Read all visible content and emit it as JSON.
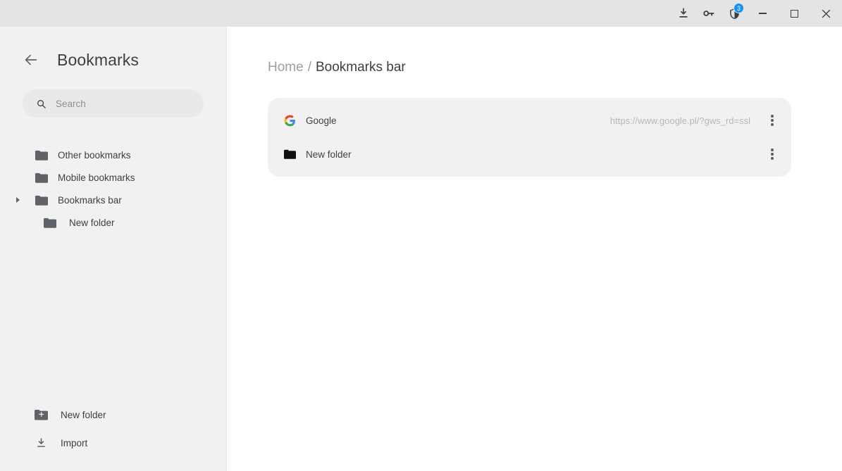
{
  "titlebar": {
    "icons": [
      {
        "name": "downloads-icon",
        "label": "Downloads"
      },
      {
        "name": "password-key-icon",
        "label": "Passwords"
      },
      {
        "name": "shield-icon",
        "label": "Protection",
        "badge": "3"
      }
    ],
    "window_controls": {
      "minimize": "Minimize",
      "maximize": "Maximize",
      "close": "Close"
    }
  },
  "sidebar": {
    "back_label": "Back",
    "title": "Bookmarks",
    "search": {
      "placeholder": "Search",
      "value": ""
    },
    "tree": [
      {
        "label": "Other bookmarks",
        "icon": "folder-icon",
        "expandable": false,
        "child": false
      },
      {
        "label": "Mobile bookmarks",
        "icon": "folder-icon",
        "expandable": false,
        "child": false
      },
      {
        "label": "Bookmarks bar",
        "icon": "folder-icon",
        "expandable": true,
        "child": false
      },
      {
        "label": "New folder",
        "icon": "folder-icon",
        "expandable": false,
        "child": true
      }
    ],
    "footer": [
      {
        "label": "New folder",
        "icon": "new-folder-icon"
      },
      {
        "label": "Import",
        "icon": "import-icon"
      }
    ]
  },
  "main": {
    "breadcrumb": {
      "home": "Home",
      "separator": "/",
      "current": "Bookmarks bar"
    },
    "rows": [
      {
        "title": "Google",
        "url": "https://www.google.pl/?gws_rd=ssl",
        "icon": "google-favicon"
      },
      {
        "title": "New folder",
        "url": "",
        "icon": "folder-icon-dark"
      }
    ]
  },
  "colors": {
    "titlebar_bg": "#e4e4e4",
    "sidebar_bg": "#f1f1f1",
    "main_bg": "#ffffff",
    "card_bg": "#f1f1f1",
    "text_primary": "#3c4043",
    "text_muted": "#9aa0a6",
    "badge_blue": "#1a90ee",
    "google_blue": "#4285f4",
    "google_red": "#ea4335",
    "google_yellow": "#fbbc05",
    "google_green": "#34a853"
  }
}
